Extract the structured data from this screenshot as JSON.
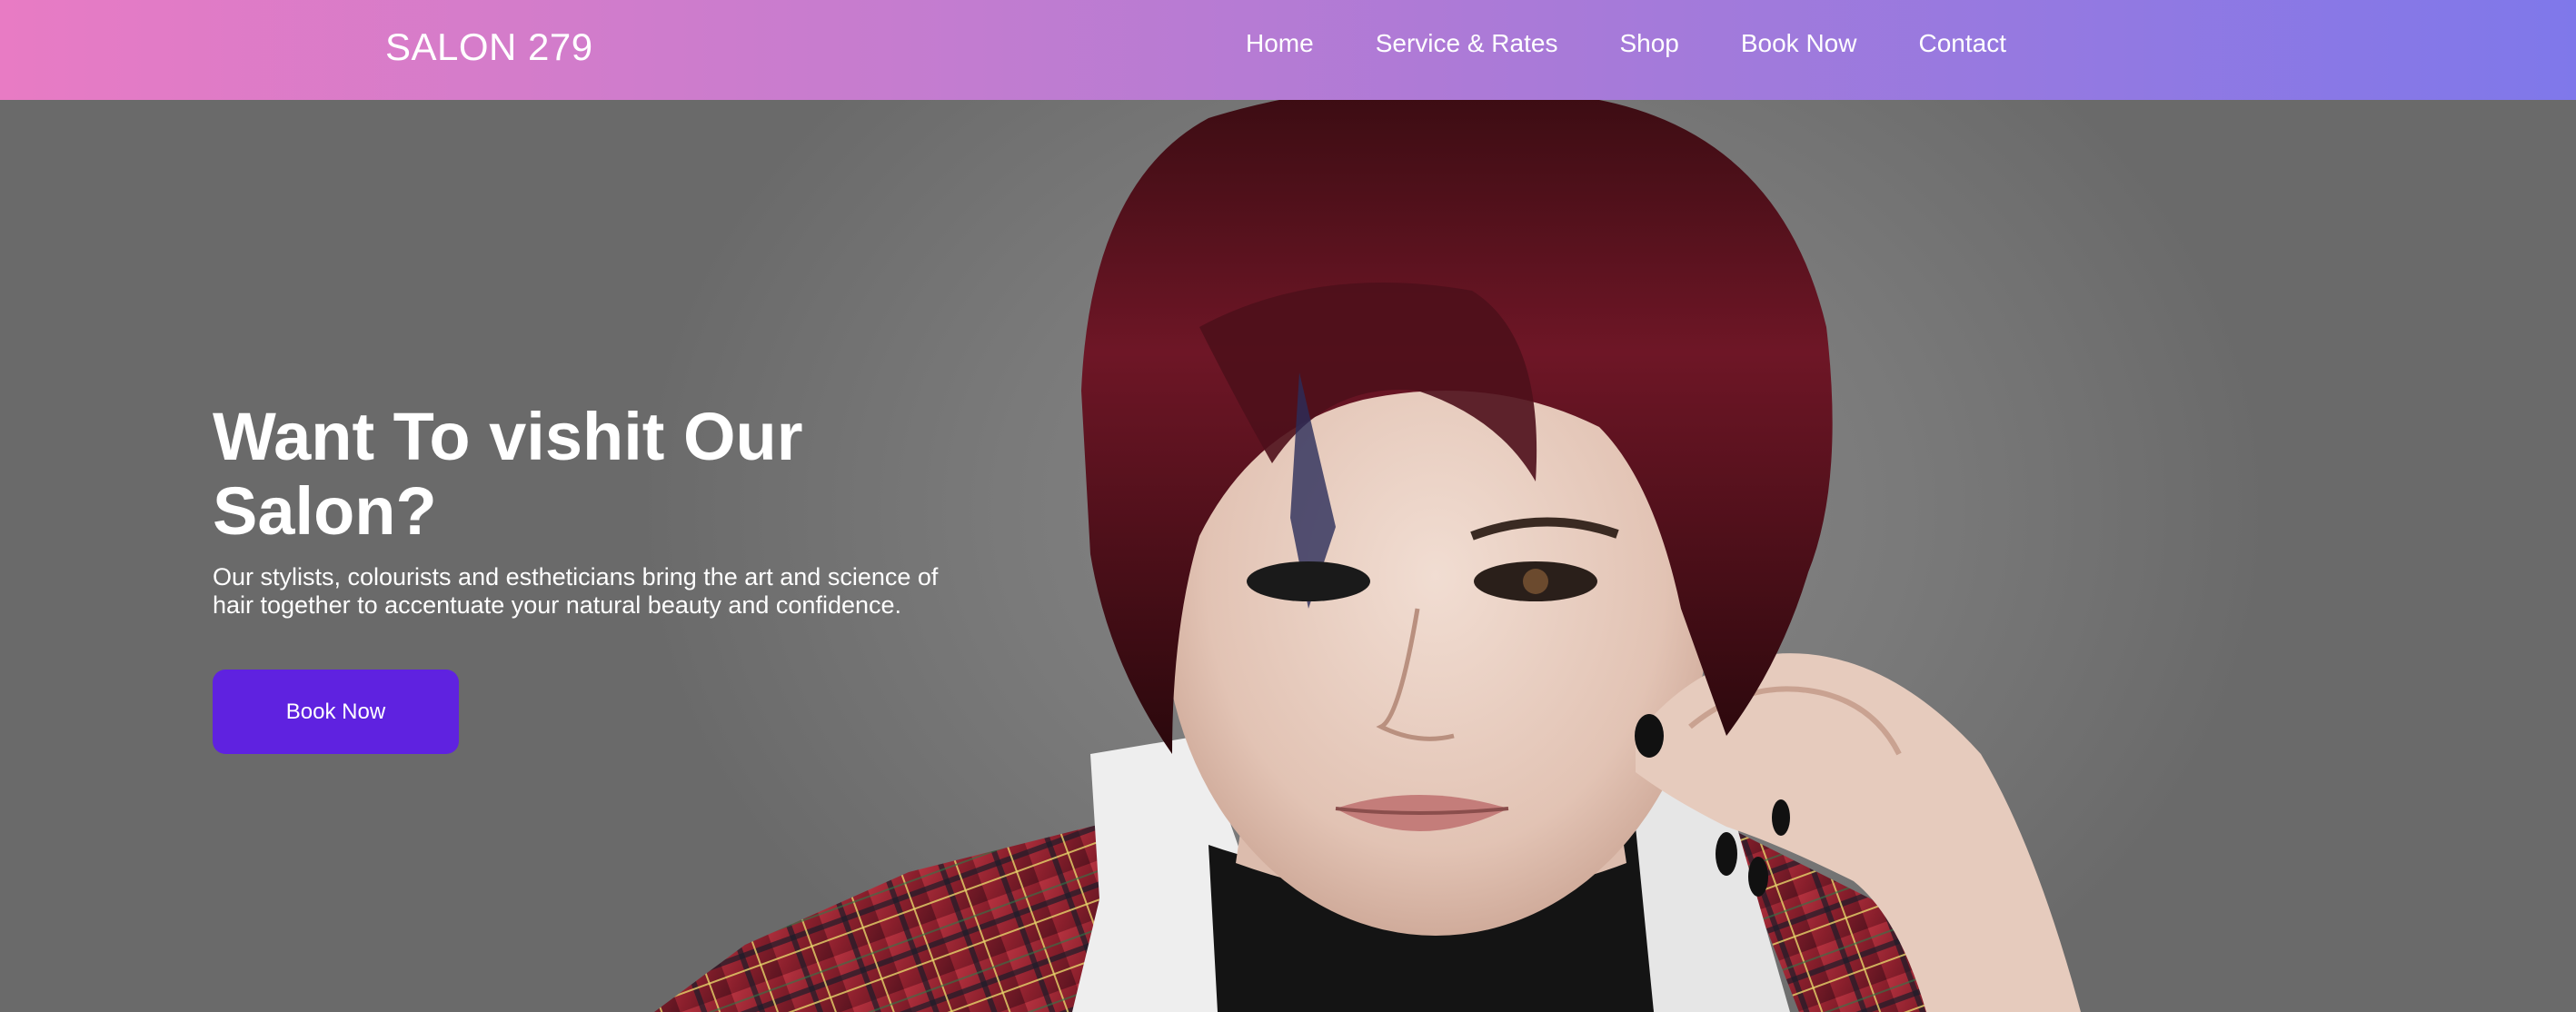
{
  "header": {
    "brand": "SALON 279",
    "nav": [
      {
        "label": "Home"
      },
      {
        "label": "Service & Rates"
      },
      {
        "label": "Shop"
      },
      {
        "label": "Book Now"
      },
      {
        "label": "Contact"
      }
    ],
    "gradient_colors": [
      "#e87bc4",
      "#7f78ea"
    ]
  },
  "hero": {
    "title": "Want To vishit Our Salon?",
    "description": "Our stylists, colourists and estheticians bring the art and science of hair together to accentuate your natural beauty and confidence.",
    "cta_label": "Book Now",
    "cta_color": "#5f22e0",
    "background_color": "#7a7a7a"
  }
}
